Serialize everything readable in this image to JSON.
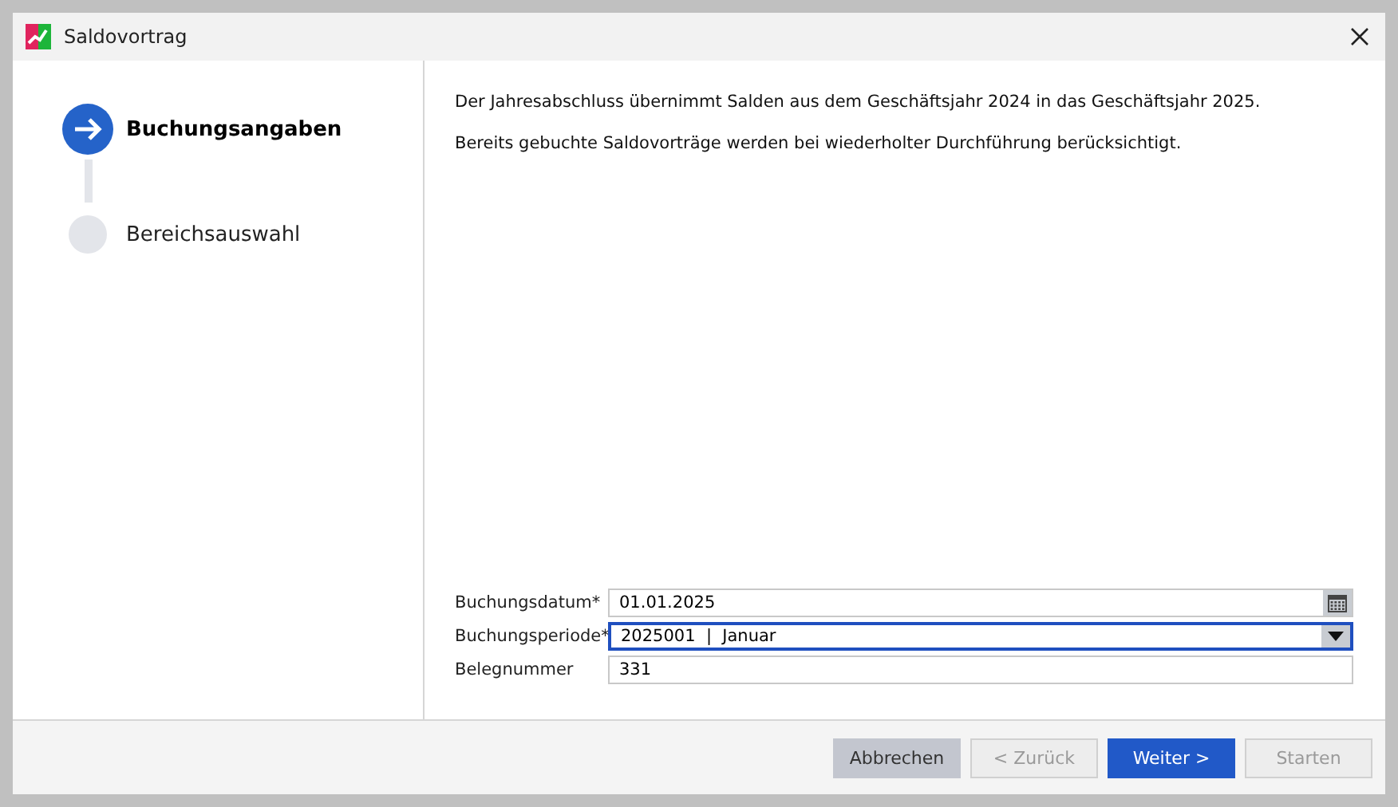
{
  "window": {
    "title": "Saldovortrag"
  },
  "steps": [
    {
      "label": "Buchungsangaben",
      "selected": true
    },
    {
      "label": "Bereichsauswahl",
      "selected": false
    }
  ],
  "info": [
    "Der Jahresabschluss übernimmt Salden aus dem Geschäftsjahr 2024 in das Geschäftsjahr 2025.",
    "Bereits gebuchte Saldovorträge werden bei wiederholter Durchführung berücksichtigt."
  ],
  "fields": [
    {
      "label": "Buchungsdatum*",
      "value": "01.01.2025",
      "kind": "date",
      "focused": false
    },
    {
      "label": "Buchungsperiode*",
      "value": "2025001  |  Januar",
      "kind": "select",
      "focused": true
    },
    {
      "label": "Belegnummer",
      "value": "331",
      "kind": "text",
      "focused": false
    }
  ],
  "buttons": [
    {
      "label": "Abbrechen",
      "kind": "secondary"
    },
    {
      "label": "< Zurück",
      "kind": "disabled"
    },
    {
      "label": "Weiter >",
      "kind": "primary"
    },
    {
      "label": "Starten",
      "kind": "disabled"
    }
  ]
}
